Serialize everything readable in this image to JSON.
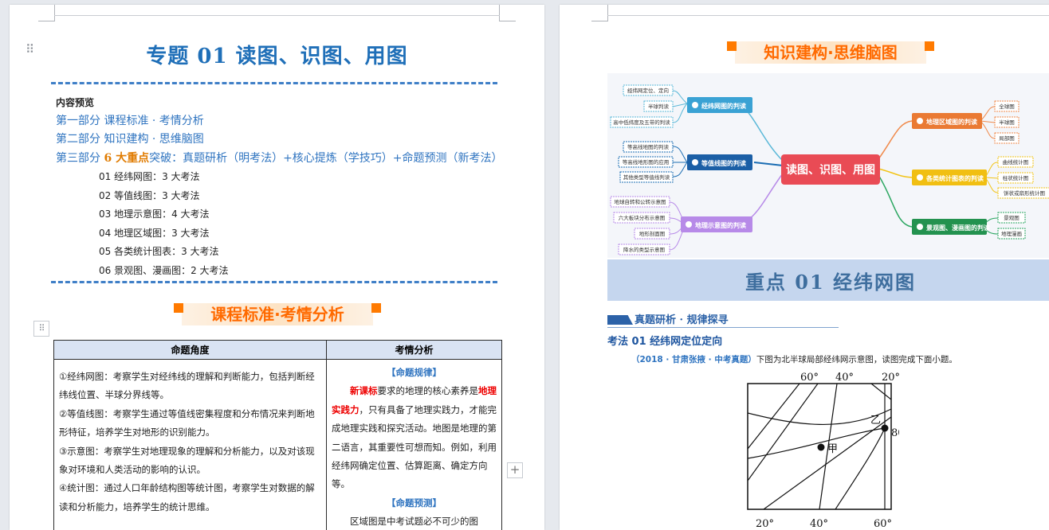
{
  "left_page": {
    "title": "专题 01  读图、识图、用图",
    "preview_heading": "内容预览",
    "parts": [
      {
        "text": "第一部分  课程标准 · 考情分析"
      },
      {
        "text": "第二部分  知识建构 · 思维脑图"
      },
      {
        "prefix": "第三部分 ",
        "highlight": "6 大重点",
        "suffix": "突破：真题研析（明考法）+核心提炼（学技巧）+命题预测（新考法）"
      }
    ],
    "items": [
      "01 经纬网图：3 大考法",
      "02 等值线图：3 大考法",
      "03 地理示意图：4 大考法",
      "04 地理区域图：3 大考法",
      "05 各类统计图表：3 大考法",
      "06 景观图、漫画图：2 大考法"
    ],
    "banner": "课程标准·考情分析",
    "table": {
      "headers": [
        "命题角度",
        "考情分析"
      ],
      "angles": [
        "①经纬网图：考察学生对经纬线的理解和判断能力，包括判断经纬线位置、半球分界线等。",
        "②等值线图：考察学生通过等值线密集程度和分布情况来判断地形特征，培养学生对地形的识别能力。",
        "③示意图：考察学生对地理现象的理解和分析能力，以及对该现象对环境和人类活动的影响的认识。",
        "④统计图：通过人口年龄结构图等统计图，考察学生对数据的解读和分析能力，培养学生的统计思维。"
      ],
      "rule_head": "【命题规律】",
      "rule_p1_a": "新课标",
      "rule_p1_b": "要求的地理的核心素养是",
      "rule_p1_c": "地理实践力",
      "rule_p1_d": "，只有具备了地理实践力，才能完成地理实践和探究活动。地图是地理的第二语言，其重要性可想而知。例如，利用经纬网确定位置、估算距离、确定方向等。",
      "predict_head": "【命题预测】",
      "predict_p1": "区域图是中考试题必不可少的图"
    }
  },
  "right_page": {
    "banner": "知识建构·思维脑图",
    "mindmap": {
      "center": "读图、识图、用图",
      "branches": [
        {
          "name": "经纬网图的判读",
          "leaves": [
            "经纬网定位、定向",
            "半球判读",
            "高中低纬度及五带的判读"
          ]
        },
        {
          "name": "等值线图的判读",
          "leaves": [
            "等高线地图的判读",
            "等高线地形图的应用",
            "其他类型等值线判读"
          ]
        },
        {
          "name": "地理示意图的判读",
          "leaves": [
            "地球自转和公转示意图",
            "六大板块分布示意图",
            "地形剖面图",
            "降水的类型示意图"
          ]
        },
        {
          "name": "地理区域图的判读",
          "leaves": [
            "全球图",
            "半球图",
            "局部图"
          ]
        },
        {
          "name": "各类统计图表的判读",
          "leaves": [
            "曲线统计图",
            "柱状统计图",
            "饼状或扇形统计图"
          ]
        },
        {
          "name": "景观图、漫画图的判读",
          "leaves": [
            "景观图",
            "地理漫画"
          ]
        }
      ]
    },
    "key_title": "重点 01  经纬网图",
    "section": "真题研析 · 规律探寻",
    "method": "考法 01  经纬网定位定向",
    "question_source": "（2018 · 甘肃张掖 · 中考真题）",
    "question_text": "下图为北半球局部经纬网示意图，读图完成下面小题。",
    "grid_labels": {
      "top": [
        "60°",
        "40°",
        "20°"
      ],
      "right": "80°",
      "bottom": [
        "20°",
        "40°",
        "60°"
      ],
      "point_a": "甲",
      "point_b": "乙"
    }
  },
  "colors": {
    "title_blue": "#1f6fb8",
    "part_blue": "#2f74c0",
    "orange": "#ff6a00",
    "red": "#e00000",
    "center_node": "#e94b55",
    "table_header": "#d9e3f3",
    "key_band": "#c5d6ee"
  }
}
